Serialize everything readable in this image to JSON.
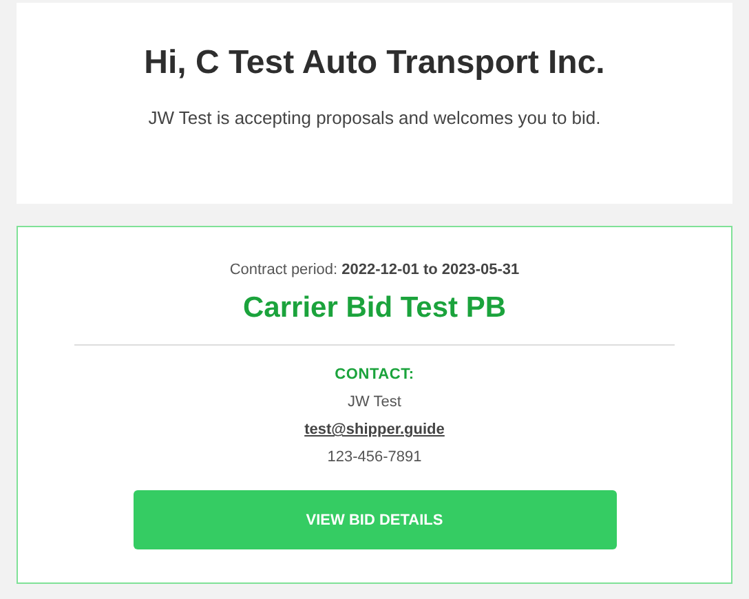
{
  "greeting": {
    "title": "Hi, C Test Auto Transport Inc.",
    "message": "JW Test is accepting proposals and welcomes you to bid."
  },
  "bid": {
    "contract_period": "Contract period: **2022-12-01 to 2023-05-31**",
    "name": "Carrier Bid Test PB",
    "contact_label": "CONTACT:",
    "contact_name": "JW Test",
    "contact_email": "test@shipper.guide",
    "contact_phone": "123-456-7891",
    "button": "VIEW BID DETAILS"
  }
}
